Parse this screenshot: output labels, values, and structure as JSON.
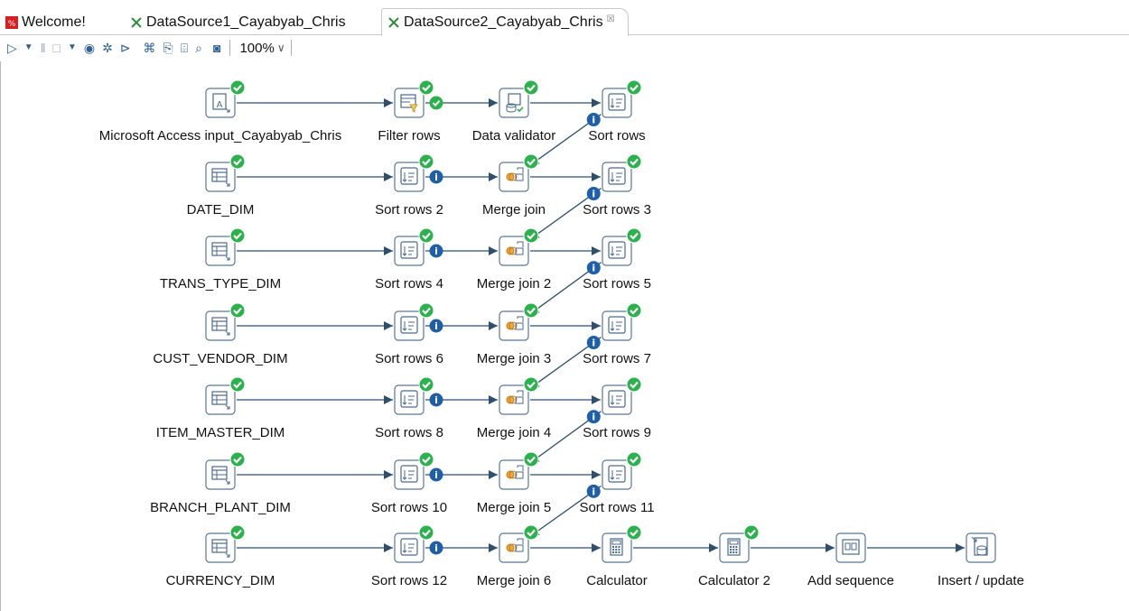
{
  "tabs": [
    {
      "label": "Welcome!",
      "icon": "welcome-icon",
      "color": "#d81e1e"
    },
    {
      "label": "DataSource1_Cayabyab_Chris",
      "icon": "transformation-icon",
      "color": "#2e8b3a"
    },
    {
      "label": "DataSource2_Cayabyab_Chris",
      "icon": "transformation-icon",
      "color": "#2e8b3a",
      "close": "☒"
    }
  ],
  "toolbar": {
    "zoom": "100%",
    "buttons": [
      "run-icon",
      "run-dropdown-icon",
      "pause-icon",
      "stop-icon",
      "stop-dropdown-icon",
      "preview-icon",
      "debug-icon",
      "replay-icon",
      "verify-icon",
      "impact-icon",
      "sql-icon",
      "explore-db-icon",
      "show-results-icon"
    ]
  },
  "colors": {
    "hop": "#2f4f6f",
    "ok": "#2bb24c",
    "info": "#1e5fa8",
    "node_border": "#5b7796",
    "node_icon": "#4a6a8e"
  },
  "nodes": [
    {
      "id": "access_input",
      "label": "Microsoft Access input_Cayabyab_Chris",
      "type": "access"
    },
    {
      "id": "filter_rows",
      "label": "Filter rows",
      "type": "filter"
    },
    {
      "id": "data_validator",
      "label": "Data validator",
      "type": "validator"
    },
    {
      "id": "sort_rows",
      "label": "Sort rows",
      "type": "sort"
    },
    {
      "id": "date_dim",
      "label": "DATE_DIM",
      "type": "table"
    },
    {
      "id": "sort_rows_2",
      "label": "Sort rows 2",
      "type": "sort"
    },
    {
      "id": "merge_join",
      "label": "Merge join",
      "type": "merge"
    },
    {
      "id": "sort_rows_3",
      "label": "Sort rows 3",
      "type": "sort"
    },
    {
      "id": "trans_type_dim",
      "label": "TRANS_TYPE_DIM",
      "type": "table"
    },
    {
      "id": "sort_rows_4",
      "label": "Sort rows 4",
      "type": "sort"
    },
    {
      "id": "merge_join_2",
      "label": "Merge join 2",
      "type": "merge"
    },
    {
      "id": "sort_rows_5",
      "label": "Sort rows 5",
      "type": "sort"
    },
    {
      "id": "cust_vendor_dim",
      "label": "CUST_VENDOR_DIM",
      "type": "table"
    },
    {
      "id": "sort_rows_6",
      "label": "Sort rows 6",
      "type": "sort"
    },
    {
      "id": "merge_join_3",
      "label": "Merge join 3",
      "type": "merge"
    },
    {
      "id": "sort_rows_7",
      "label": "Sort rows 7",
      "type": "sort"
    },
    {
      "id": "item_master_dim",
      "label": "ITEM_MASTER_DIM",
      "type": "table"
    },
    {
      "id": "sort_rows_8",
      "label": "Sort rows 8",
      "type": "sort"
    },
    {
      "id": "merge_join_4",
      "label": "Merge join 4",
      "type": "merge"
    },
    {
      "id": "sort_rows_9",
      "label": "Sort rows 9",
      "type": "sort"
    },
    {
      "id": "branch_plant_dim",
      "label": "BRANCH_PLANT_DIM",
      "type": "table"
    },
    {
      "id": "sort_rows_10",
      "label": "Sort rows 10",
      "type": "sort"
    },
    {
      "id": "merge_join_5",
      "label": "Merge join 5",
      "type": "merge"
    },
    {
      "id": "sort_rows_11",
      "label": "Sort rows 11",
      "type": "sort"
    },
    {
      "id": "currency_dim",
      "label": "CURRENCY_DIM",
      "type": "table"
    },
    {
      "id": "sort_rows_12",
      "label": "Sort rows 12",
      "type": "sort"
    },
    {
      "id": "merge_join_6",
      "label": "Merge join 6",
      "type": "merge"
    },
    {
      "id": "calculator",
      "label": "Calculator",
      "type": "calc"
    },
    {
      "id": "calculator_2",
      "label": "Calculator 2",
      "type": "calc"
    },
    {
      "id": "add_sequence",
      "label": "Add sequence",
      "type": "sequence"
    },
    {
      "id": "insert_update",
      "label": "Insert / update",
      "type": "insert"
    }
  ],
  "hops": [
    {
      "from": "access_input",
      "to": "filter_rows",
      "marker": ""
    },
    {
      "from": "filter_rows",
      "to": "data_validator",
      "marker": "ok"
    },
    {
      "from": "data_validator",
      "to": "sort_rows",
      "marker": ""
    },
    {
      "from": "sort_rows",
      "to": "merge_join",
      "marker": "info"
    },
    {
      "from": "date_dim",
      "to": "sort_rows_2",
      "marker": ""
    },
    {
      "from": "sort_rows_2",
      "to": "merge_join",
      "marker": "info"
    },
    {
      "from": "merge_join",
      "to": "sort_rows_3",
      "marker": ""
    },
    {
      "from": "sort_rows_3",
      "to": "merge_join_2",
      "marker": "info"
    },
    {
      "from": "trans_type_dim",
      "to": "sort_rows_4",
      "marker": ""
    },
    {
      "from": "sort_rows_4",
      "to": "merge_join_2",
      "marker": "info"
    },
    {
      "from": "merge_join_2",
      "to": "sort_rows_5",
      "marker": ""
    },
    {
      "from": "sort_rows_5",
      "to": "merge_join_3",
      "marker": "info"
    },
    {
      "from": "cust_vendor_dim",
      "to": "sort_rows_6",
      "marker": ""
    },
    {
      "from": "sort_rows_6",
      "to": "merge_join_3",
      "marker": "info"
    },
    {
      "from": "merge_join_3",
      "to": "sort_rows_7",
      "marker": ""
    },
    {
      "from": "sort_rows_7",
      "to": "merge_join_4",
      "marker": "info"
    },
    {
      "from": "item_master_dim",
      "to": "sort_rows_8",
      "marker": ""
    },
    {
      "from": "sort_rows_8",
      "to": "merge_join_4",
      "marker": "info"
    },
    {
      "from": "merge_join_4",
      "to": "sort_rows_9",
      "marker": ""
    },
    {
      "from": "sort_rows_9",
      "to": "merge_join_5",
      "marker": "info"
    },
    {
      "from": "branch_plant_dim",
      "to": "sort_rows_10",
      "marker": ""
    },
    {
      "from": "sort_rows_10",
      "to": "merge_join_5",
      "marker": "info"
    },
    {
      "from": "merge_join_5",
      "to": "sort_rows_11",
      "marker": ""
    },
    {
      "from": "sort_rows_11",
      "to": "merge_join_6",
      "marker": "info"
    },
    {
      "from": "currency_dim",
      "to": "sort_rows_12",
      "marker": ""
    },
    {
      "from": "sort_rows_12",
      "to": "merge_join_6",
      "marker": "info"
    },
    {
      "from": "merge_join_6",
      "to": "calculator",
      "marker": ""
    },
    {
      "from": "calculator",
      "to": "calculator_2",
      "marker": ""
    },
    {
      "from": "calculator_2",
      "to": "add_sequence",
      "marker": ""
    },
    {
      "from": "add_sequence",
      "to": "insert_update",
      "marker": ""
    }
  ]
}
